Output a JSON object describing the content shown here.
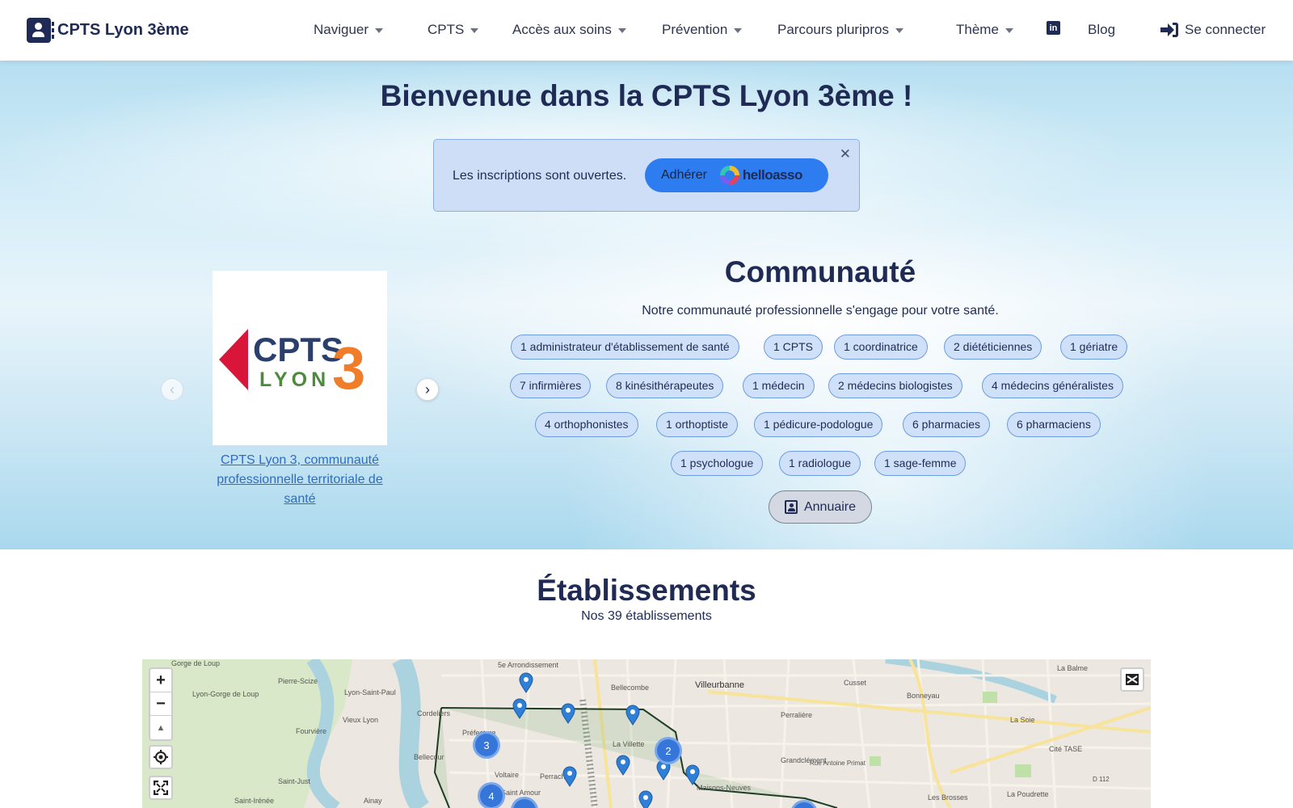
{
  "navbar": {
    "brand": "CPTS Lyon 3ème",
    "items": [
      {
        "label": "Naviguer"
      },
      {
        "label": "CPTS"
      },
      {
        "label": "Accès aux soins"
      },
      {
        "label": "Prévention"
      },
      {
        "label": "Parcours pluripros"
      },
      {
        "label": "Thème"
      }
    ],
    "blog": "Blog",
    "login": "Se connecter",
    "icons": {
      "brand": "address-book-icon",
      "linkedin": "linkedin-icon",
      "login": "sign-in-icon",
      "caret": "caret-down-icon"
    }
  },
  "hero": {
    "title": "Bienvenue dans la CPTS Lyon 3ème !",
    "alert": {
      "text": "Les inscriptions sont ouvertes.",
      "button_label": "Adhérer",
      "button_brand": "helloasso"
    }
  },
  "carousel": {
    "logo_text_top": "CPTS",
    "logo_digit": "3",
    "logo_text_bottom": "LYON",
    "caption": "CPTS Lyon 3, communauté professionnelle territoriale de santé"
  },
  "community": {
    "title": "Communauté",
    "subtitle": "Notre communauté professionnelle s'engage pour votre santé.",
    "badges": [
      "1 administrateur d'établissement de santé",
      "1 CPTS",
      "1 coordinatrice",
      "2 diététiciennes",
      "1 gériatre",
      "7 infirmières",
      "8 kinésithérapeutes",
      "1 médecin",
      "2 médecins biologistes",
      "4 médecins généralistes",
      "4 orthophonistes",
      "1 orthoptiste",
      "1 pédicure-podologue",
      "6 pharmacies",
      "6 pharmaciens",
      "1 psychologue",
      "1 radiologue",
      "1 sage-femme"
    ],
    "directory_button": "Annuaire"
  },
  "establishments": {
    "title": "Établissements",
    "subtitle": "Nos 39 établissements"
  },
  "map": {
    "zoom_in": "+",
    "zoom_out": "−",
    "clusters": [
      "3",
      "2",
      "4"
    ],
    "labels": [
      "Gorge de Loup",
      "5e Arrondissement",
      "Bellecombe",
      "Villeurbanne",
      "Pierre-Scize",
      "Lyon-Gorge de Loup",
      "Lyon-Saint-Paul",
      "Cordeliers",
      "Fourvière",
      "Vieux Lyon",
      "Bellecour",
      "Préfecture",
      "La Villette",
      "Perrache",
      "Voltaire",
      "Saint Amour",
      "Maisons-Neuves",
      "Grandclément",
      "Cusset",
      "Bonneyau",
      "La Soie",
      "Cité TASE",
      "Les Brosses",
      "La Poudrette",
      "Saint-Irénée",
      "Saint-Just",
      "Ainay",
      "Perralière",
      "La Balme",
      "Rue Antoine Primat",
      "D 112"
    ]
  }
}
